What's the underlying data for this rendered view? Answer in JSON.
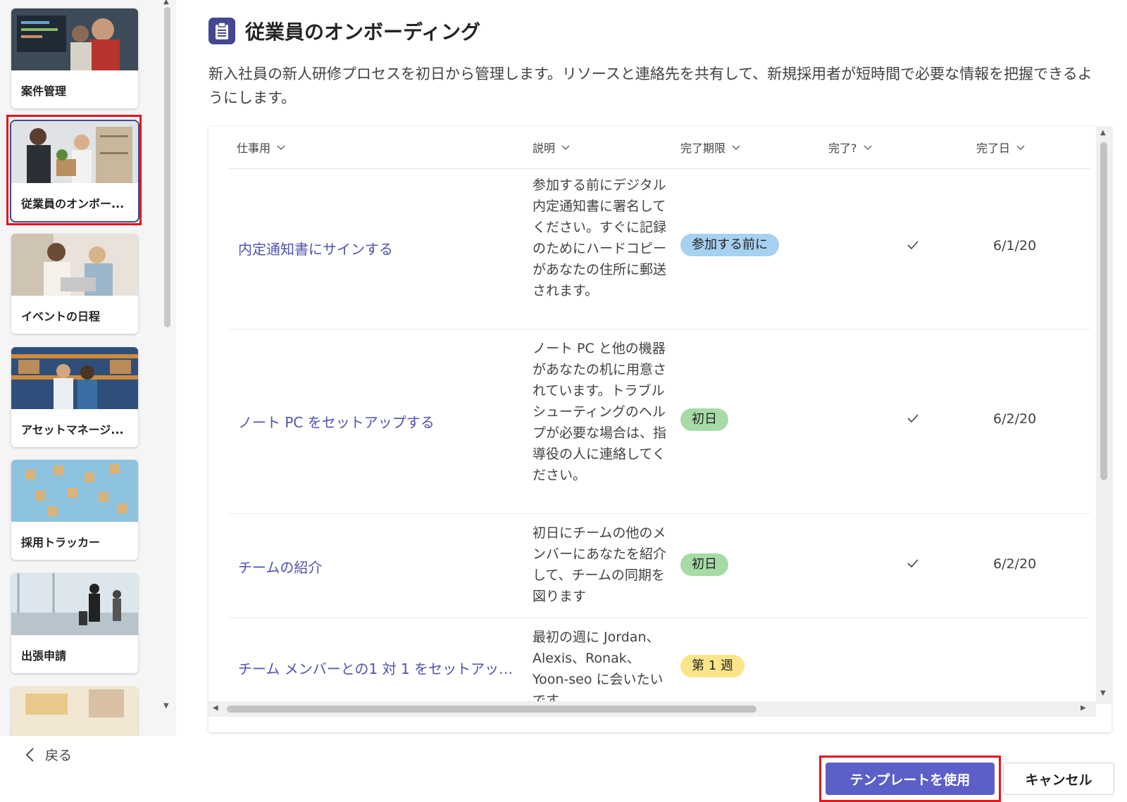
{
  "sidebar": {
    "templates": [
      {
        "label": "案件管理",
        "thumb_icon": "laptop-code-photo"
      },
      {
        "label": "従業員のオンボー...",
        "thumb_icon": "office-welcome-photo",
        "selected": true
      },
      {
        "label": "イベントの日程",
        "thumb_icon": "meeting-photo"
      },
      {
        "label": "アセットマネージ...",
        "thumb_icon": "warehouse-photo"
      },
      {
        "label": "採用トラッカー",
        "thumb_icon": "people-cubes-photo"
      },
      {
        "label": "出張申請",
        "thumb_icon": "airport-travel-photo"
      },
      {
        "label": "",
        "thumb_icon": "desk-photo"
      }
    ]
  },
  "header": {
    "title": "従業員のオンボーディング",
    "title_icon": "clipboard-icon",
    "description": "新入社員の新人研修プロセスを初日から管理します。リソースと連絡先を共有して、新規採用者が短時間で必要な情報を把握できるようにします。"
  },
  "table": {
    "columns": [
      "仕事用",
      "説明",
      "完了期限",
      "完了?",
      "完了日"
    ],
    "rows": [
      {
        "task": "内定通知書にサインする",
        "description": "参加する前にデジタル内定通知書に署名してください。すぐに記録のためにハードコピーがあなたの住所に郵送されます。",
        "due": "参加する前に",
        "done": true,
        "date": "6/1/20"
      },
      {
        "task": "ノート PC をセットアップする",
        "description": "ノート PC と他の機器があなたの机に用意されています。トラブルシューティングのヘルプが必要な場合は、指導役の人に連絡してください。",
        "due": "初日",
        "done": true,
        "date": "6/2/20"
      },
      {
        "task": "チームの紹介",
        "description": "初日にチームの他のメンバーにあなたを紹介して、チームの同期を図ります",
        "due": "初日",
        "done": true,
        "date": "6/2/20"
      },
      {
        "task": "チーム メンバーとの1 対 1 をセットアップ...",
        "description": "最初の週に Jordan、Alexis、Ronak、Yoon-seo に会いたいです",
        "due": "第 1 週",
        "done": false,
        "date": ""
      }
    ]
  },
  "footer": {
    "back_label": "戻る",
    "use_template_label": "テンプレートを使用",
    "cancel_label": "キャンセル"
  },
  "colors": {
    "accent": "#5b5fc7",
    "link": "#4f52b2",
    "badge_before": "#a7d1f0",
    "badge_first_day": "#a6dba6",
    "badge_week1": "#fbe58a",
    "annotation_red": "#e8131b"
  }
}
